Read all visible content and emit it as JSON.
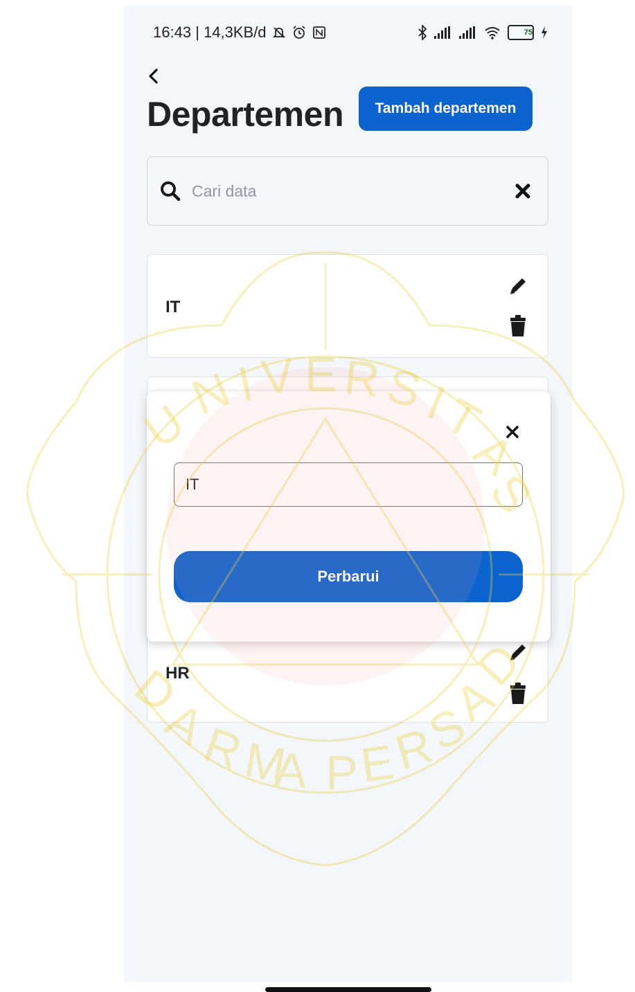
{
  "status_bar": {
    "left_text": "16:43 | 14,3KB/d",
    "battery_level": "75",
    "icons": [
      "mute-bell-icon",
      "alarm-icon",
      "nfc-icon",
      "bluetooth-icon",
      "signal-icon",
      "signal-icon",
      "wifi-icon",
      "battery-icon",
      "charging-icon"
    ]
  },
  "header": {
    "title": "Departemen",
    "add_button_label": "Tambah departemen"
  },
  "search": {
    "placeholder": "Cari data",
    "value": ""
  },
  "departments": [
    {
      "name": "IT"
    },
    {
      "name": "HR"
    }
  ],
  "edit_modal": {
    "input_value": "IT",
    "submit_label": "Perbarui"
  },
  "colors": {
    "primary": "#0b63ce",
    "background": "#f3f6fa",
    "text": "#1f2328",
    "watermark": "#f0d84a"
  }
}
